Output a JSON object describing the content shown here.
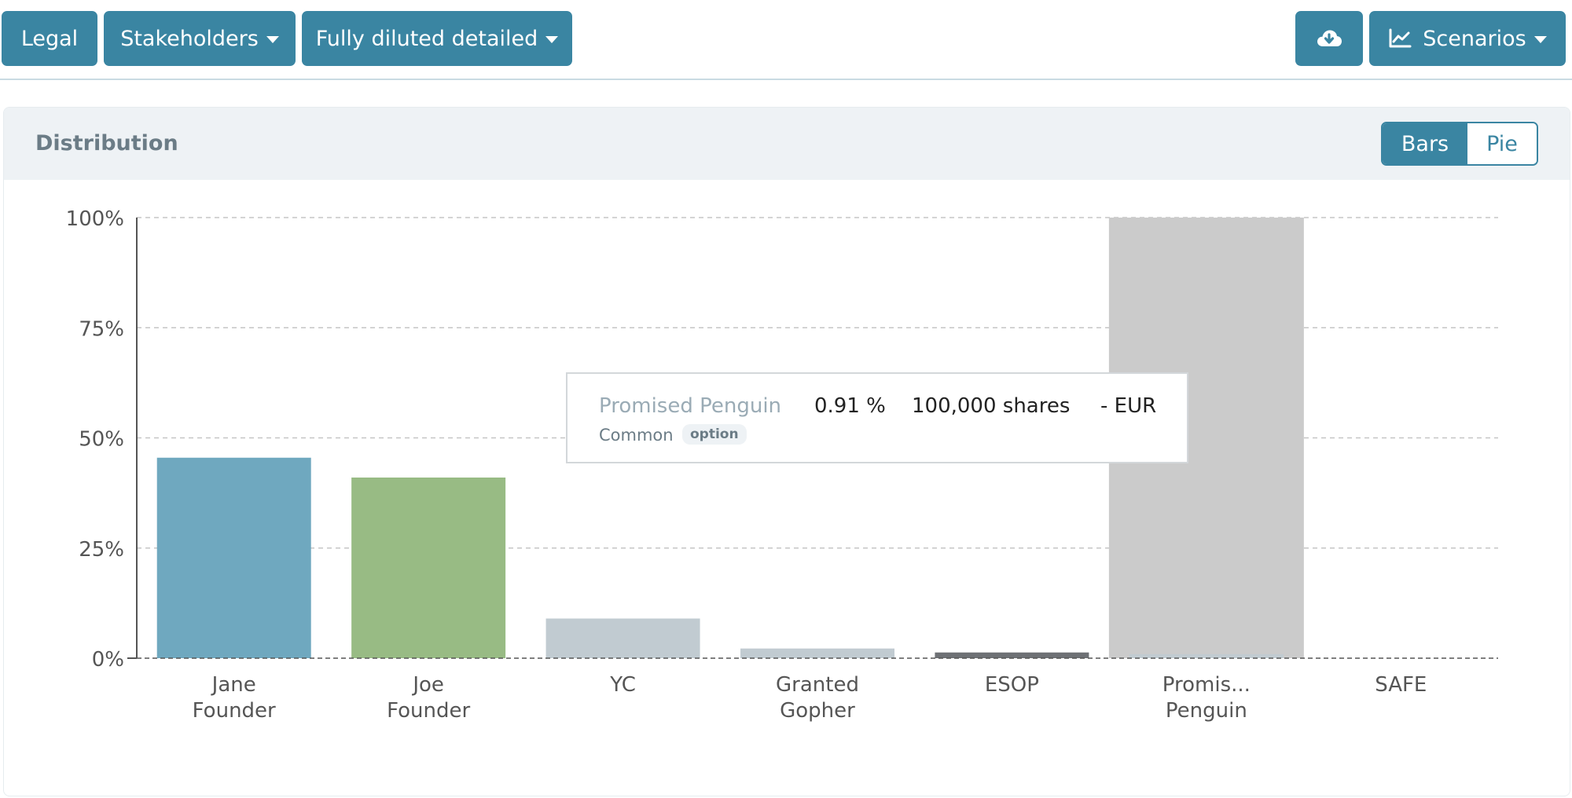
{
  "toolbar": {
    "legal_label": "Legal",
    "stakeholders_label": "Stakeholders",
    "view_label": "Fully diluted detailed",
    "download_icon": "cloud-download-icon",
    "scenarios_label": "Scenarios",
    "scenarios_icon": "line-chart-icon"
  },
  "card": {
    "title": "Distribution",
    "toggle": {
      "bars_label": "Bars",
      "pie_label": "Pie",
      "selected": "Bars"
    }
  },
  "tooltip": {
    "name": "Promised Penguin",
    "percent": "0.91 %",
    "shares": "100,000 shares",
    "currency": "- EUR",
    "share_class": "Common",
    "badge": "option"
  },
  "colors": {
    "accent": "#3a85a2"
  },
  "chart_data": {
    "type": "bar",
    "categories": [
      [
        "Jane",
        "Founder"
      ],
      [
        "Joe",
        "Founder"
      ],
      [
        "YC"
      ],
      [
        "Granted",
        "Gopher"
      ],
      [
        "ESOP"
      ],
      [
        "Promis...",
        "Penguin"
      ],
      [
        "SAFE"
      ]
    ],
    "values": [
      45.5,
      41,
      9,
      2.2,
      1.3,
      0.91,
      0
    ],
    "highlight_index": 5,
    "colors": [
      "#6fa8bf",
      "#98bb84",
      "#c1cbd1",
      "#c1cbd1",
      "#6e7175",
      "#c1cbd1",
      "#c1cbd1"
    ],
    "ylim": [
      0,
      100
    ],
    "yticks": [
      0,
      25,
      50,
      75,
      100
    ],
    "ytick_labels": [
      "0%",
      "25%",
      "50%",
      "75%",
      "100%"
    ],
    "grid": true
  }
}
